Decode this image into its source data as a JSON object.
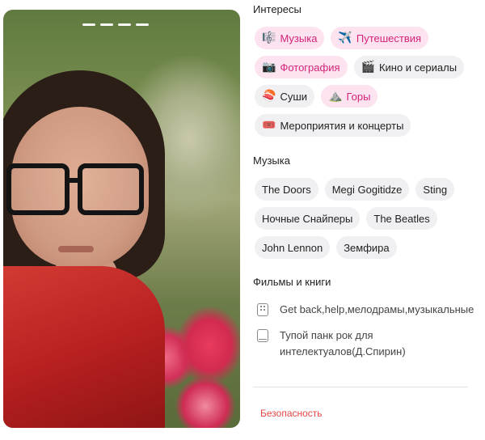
{
  "interests": {
    "title": "Интересы",
    "items": [
      {
        "label": "Музыка",
        "icon": "🎼",
        "icon_name": "music-score-icon",
        "highlighted": true
      },
      {
        "label": "Путешествия",
        "icon": "✈️",
        "icon_name": "airplane-icon",
        "highlighted": true
      },
      {
        "label": "Фотография",
        "icon": "📷",
        "icon_name": "camera-icon",
        "highlighted": true
      },
      {
        "label": "Кино и сериалы",
        "icon": "🎬",
        "icon_name": "clapperboard-icon",
        "highlighted": false
      },
      {
        "label": "Суши",
        "icon": "🍣",
        "icon_name": "sushi-icon",
        "highlighted": false
      },
      {
        "label": "Горы",
        "icon": "⛰️",
        "icon_name": "mountain-icon",
        "highlighted": true
      },
      {
        "label": "Мероприятия и концерты",
        "icon": "🎟️",
        "icon_name": "ticket-icon",
        "highlighted": false
      }
    ]
  },
  "music": {
    "title": "Музыка",
    "items": [
      "The Doors",
      "Megi Gogitidze",
      "Sting",
      "Ночные Снайперы",
      "The Beatles",
      "John Lennon",
      "Земфира"
    ]
  },
  "films_books": {
    "title": "Фильмы и книги",
    "items": [
      {
        "icon": "grid",
        "icon_name": "film-icon",
        "text": "Get back,help,мелодрамы,музыкальные"
      },
      {
        "icon": "bk",
        "icon_name": "book-icon",
        "text": "Тупой панк рок для интелектуалов(Д.Спирин)"
      }
    ]
  },
  "security": {
    "label": "Безопасность"
  },
  "colors": {
    "accent_pink_bg": "#fde3ef",
    "accent_pink_text": "#d3247a",
    "chip_bg": "#f0f0f3",
    "danger": "#e64646"
  }
}
